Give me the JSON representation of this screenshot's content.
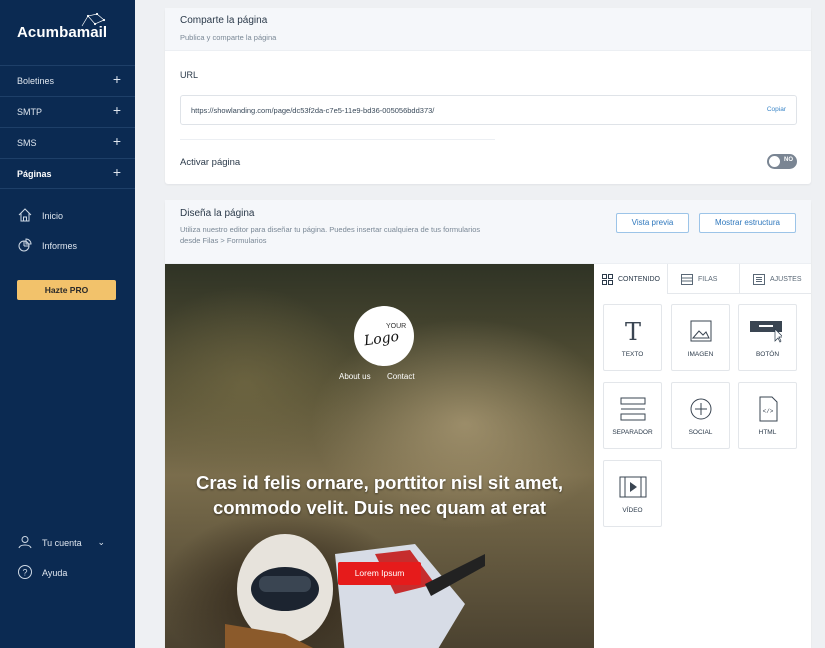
{
  "brand": {
    "name": "Acumbamail"
  },
  "sidebar": {
    "items": [
      {
        "label": "Boletines"
      },
      {
        "label": "SMTP"
      },
      {
        "label": "SMS"
      },
      {
        "label": "Páginas"
      }
    ],
    "links": [
      {
        "label": "Inicio",
        "icon": "home-icon"
      },
      {
        "label": "Informes",
        "icon": "reports-icon"
      }
    ],
    "pro_label": "Hazte PRO",
    "account_label": "Tu cuenta",
    "help_label": "Ayuda"
  },
  "share_card": {
    "title": "Comparte la página",
    "subtitle": "Publica y comparte la página",
    "url_label": "URL",
    "url_value": "https://showlanding.com/page/dc53f2da-c7e5-11e9-bd36-005056bdd373/",
    "copy_label": "Copiar",
    "activate_label": "Activar página",
    "toggle_label": "NO"
  },
  "design_card": {
    "title": "Diseña la página",
    "subtitle_line1": "Utiliza nuestro editor para diseñar tu página. Puedes insertar cualquiera de tus formularios",
    "subtitle_line2": "desde Filas > Formularios",
    "preview_label": "Vista previa",
    "structure_label": "Mostrar estructura"
  },
  "hero": {
    "logo_your": "YOUR",
    "logo_text": "Logo",
    "nav_about": "About us",
    "nav_contact": "Contact",
    "headline_line1": "Cras id felis ornare, porttitor nisl sit amet,",
    "headline_line2": "commodo velit. Duis nec quam at erat",
    "cta_label": "Lorem Ipsum"
  },
  "panel": {
    "tabs": [
      {
        "label": "CONTENIDO"
      },
      {
        "label": "FILAS"
      },
      {
        "label": "AJUSTES"
      }
    ],
    "blocks": [
      {
        "label": "TEXTO"
      },
      {
        "label": "IMAGEN"
      },
      {
        "label": "BOTÓN"
      },
      {
        "label": "SEPARADOR"
      },
      {
        "label": "SOCIAL"
      },
      {
        "label": "HTML"
      },
      {
        "label": "VÍDEO"
      }
    ]
  }
}
